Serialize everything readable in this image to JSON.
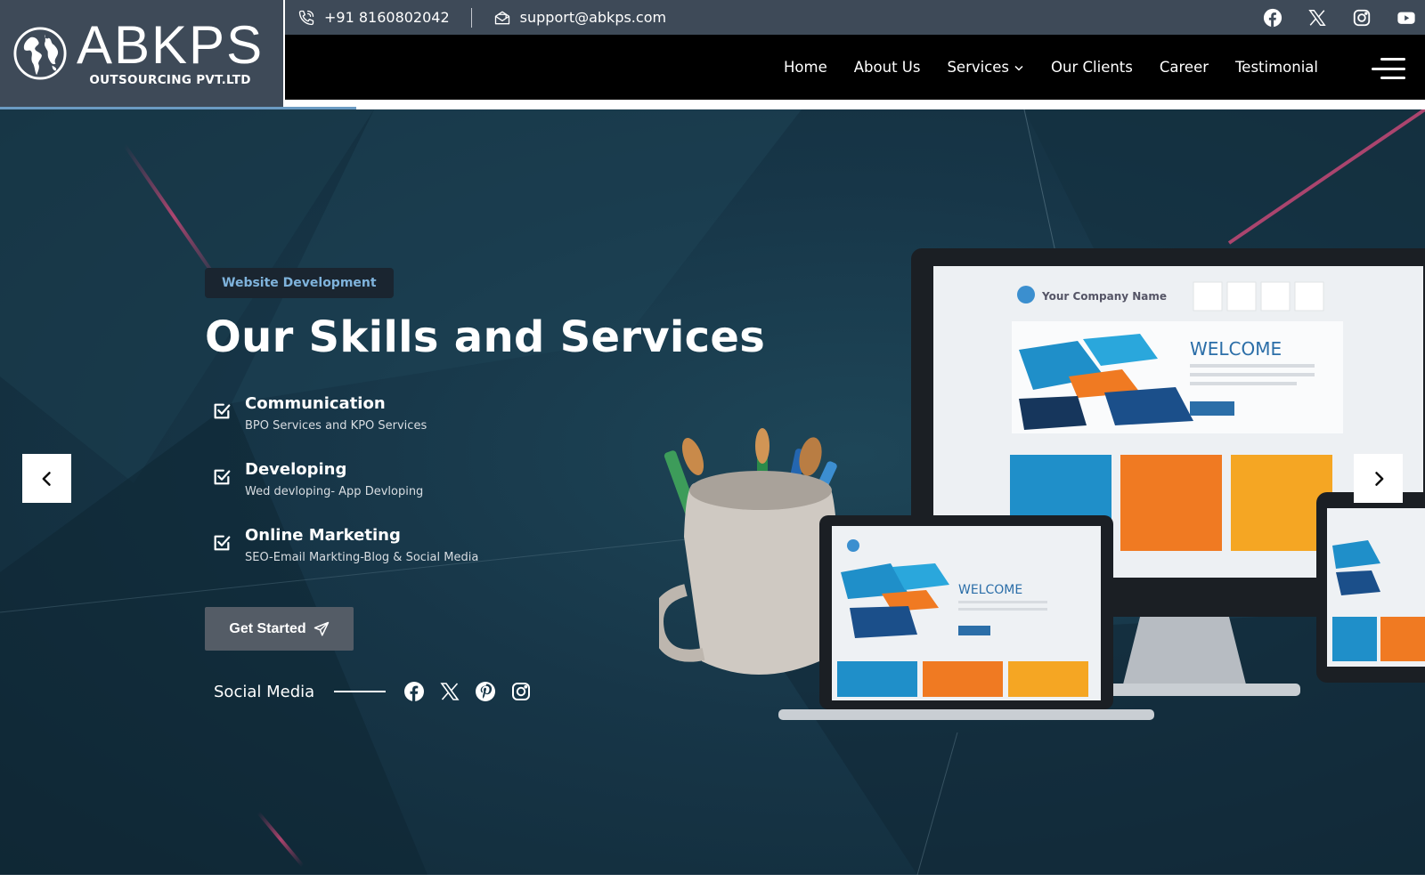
{
  "brand": {
    "name": "ABKPS",
    "tagline": "OUTSOURCING PVT.LTD"
  },
  "topbar": {
    "phone": "+91 8160802042",
    "email": "support@abkps.com",
    "social_icons": [
      "facebook-icon",
      "x-icon",
      "instagram-icon",
      "youtube-icon"
    ]
  },
  "nav": {
    "items": [
      {
        "label": "Home"
      },
      {
        "label": "About Us"
      },
      {
        "label": "Services"
      },
      {
        "label": "Our Clients"
      },
      {
        "label": "Career"
      },
      {
        "label": "Testimonial"
      }
    ],
    "services_chevron": "chevron-down-icon",
    "menu_icon": "hamburger-icon"
  },
  "hero": {
    "tag": "Website Development",
    "title": "Our Skills and Services",
    "features": [
      {
        "title": "Communication",
        "desc": "BPO Services and KPO Services"
      },
      {
        "title": "Developing",
        "desc": "Wed devloping- App Devloping"
      },
      {
        "title": "Online Marketing",
        "desc": "SEO-Email Markting-Blog & Social Media"
      }
    ],
    "cta_label": "Get Started",
    "social_label": "Social Media",
    "social_icons": [
      "facebook-icon",
      "x-icon",
      "pinterest-icon",
      "instagram-icon"
    ]
  },
  "mockup": {
    "company_name": "Your Company Name",
    "welcome": "WELCOME"
  },
  "colors": {
    "topbar_bg": "#3e4a58",
    "nav_bg": "#000000",
    "hero_bg": "#173648",
    "tag_text": "#7fb3dc",
    "cta_bg": "#545c66",
    "tile_blue": "#1f8fc9",
    "tile_orange": "#f07a22",
    "tile_yellow": "#f5a623"
  }
}
